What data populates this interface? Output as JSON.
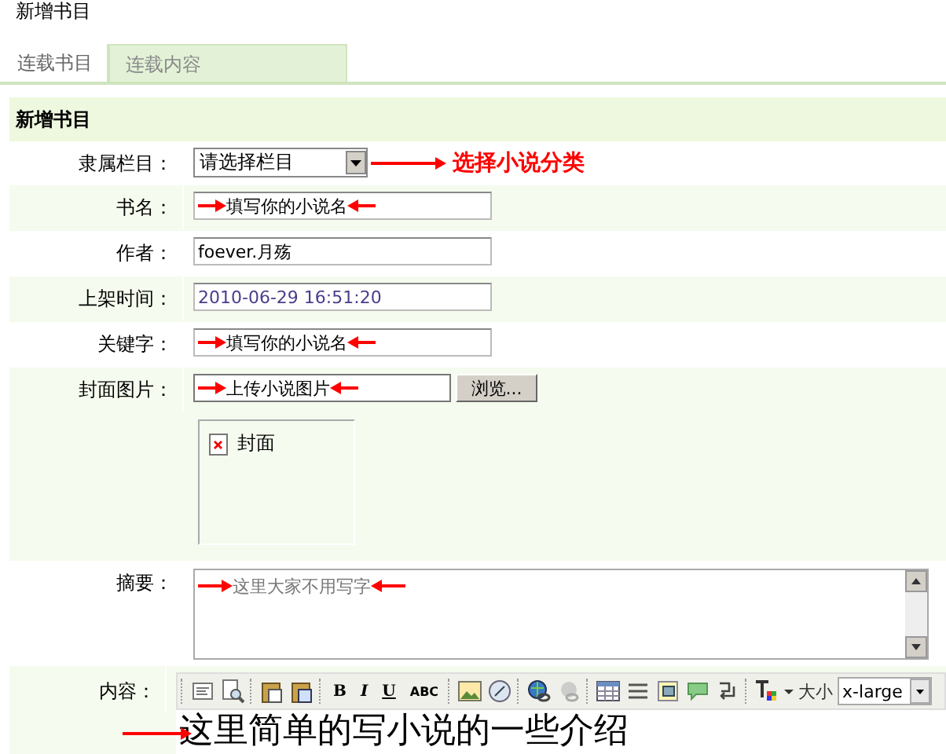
{
  "page": {
    "title": "新增书目"
  },
  "tabs": [
    {
      "label": "连载书目",
      "selected": true
    },
    {
      "label": "连载内容",
      "selected": false
    }
  ],
  "form": {
    "heading": "新增书目",
    "rows": [
      {
        "kind": "select",
        "label": "隶属栏目：",
        "value": "请选择栏目",
        "note": "选择小说分类"
      },
      {
        "kind": "text",
        "label": "书名：",
        "value": "填写你的小说名",
        "arrows": true
      },
      {
        "kind": "text",
        "label": "作者：",
        "value": "foever.月殇",
        "arrows": false
      },
      {
        "kind": "text",
        "label": "上架时间：",
        "value": "2010-06-29 16:51:20",
        "arrows": false
      },
      {
        "kind": "text",
        "label": "关键字：",
        "value": "填写你的小说名",
        "arrows": true
      },
      {
        "kind": "file",
        "label": "封面图片：",
        "value": "上传小说图片",
        "arrows": true,
        "button": "浏览...",
        "preview_alt": "封面"
      },
      {
        "kind": "textarea",
        "label": "摘要：",
        "value": "这里大家不用写字",
        "arrows": true
      },
      {
        "kind": "editor",
        "label": "内容：",
        "value": "这里简单的写小说的一些介绍",
        "arrows": true,
        "toolbar": {
          "format_buttons": [
            "B",
            "I",
            "U",
            "ABC"
          ],
          "size_label": "大小",
          "size_value": "x-large"
        }
      }
    ]
  }
}
